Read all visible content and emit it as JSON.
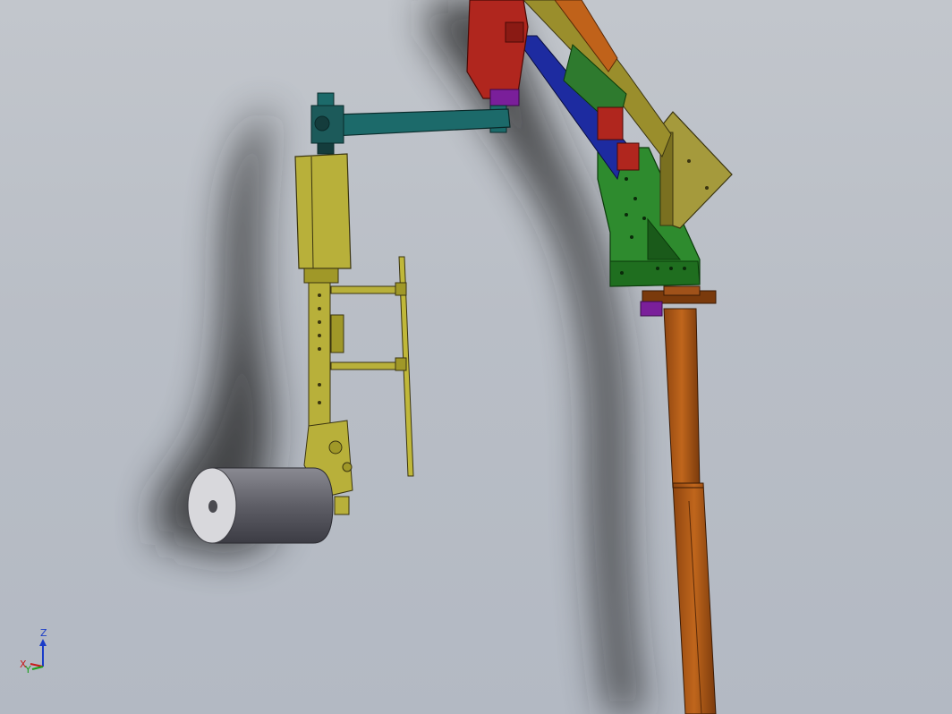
{
  "viewport": {
    "background_top": "#c2c6cc",
    "background_bottom": "#b3b9c3"
  },
  "model": {
    "colors": {
      "column": "#b85a14",
      "column_dark": "#7a3a0c",
      "mount_green": "#2e8b2e",
      "plate_olive": "#a59a3c",
      "arm_blue": "#1d2ba0",
      "arm_orange": "#c0621a",
      "arm_olive": "#9a8e2c",
      "red_block": "#b0261e",
      "purple": "#7a1f9a",
      "teal_arm": "#1c6a6a",
      "gripper_yellow": "#b8b03a",
      "roll_gray": "#6e6e74"
    }
  },
  "triad": {
    "z_label": "Z",
    "x_label": "X",
    "y_label": "Y",
    "z_color": "#1a3cc8",
    "x_color": "#c81a1a",
    "y_color": "#1aa01a"
  }
}
